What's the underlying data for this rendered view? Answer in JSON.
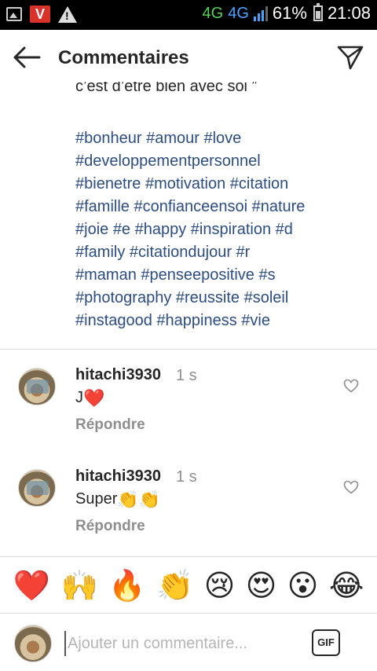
{
  "status_bar": {
    "network_1": "4G",
    "network_2": "4G",
    "battery": "61%",
    "time": "21:08",
    "notification_v": "V",
    "warning_mark": "!"
  },
  "header": {
    "title": "Commentaires"
  },
  "caption": {
    "cut_line": "c’est d’être bien avec soi ”",
    "hashtag_lines": [
      "#bonheur #amour #love",
      "#developpementpersonnel",
      "#bienetre #motivation #citation",
      "#famille #confianceensoi #nature",
      "#joie #e  #happy #inspiration #d",
      "#family #citationdujour #r",
      "#maman #penseepositive #s",
      "#photography #reussite #soleil",
      "#instagood #happiness #vie"
    ]
  },
  "comments": [
    {
      "username": "hitachi3930",
      "time": "1 s",
      "text": "J",
      "emoji": "❤️",
      "reply": "Répondre"
    },
    {
      "username": "hitachi3930",
      "time": "1 s",
      "text": "Super",
      "emoji": "👏👏",
      "reply": "Répondre"
    }
  ],
  "emoji_bar": [
    "❤️",
    "🙌",
    "🔥",
    "👏",
    "😢",
    "😍",
    "😮",
    "😂"
  ],
  "input": {
    "placeholder": "Ajouter un commentaire...",
    "gif_label": "GIF"
  },
  "colors": {
    "hashtag": "#2d4d80",
    "muted": "#8e8e8e",
    "text": "#262626",
    "divider": "#dbdbdb"
  }
}
